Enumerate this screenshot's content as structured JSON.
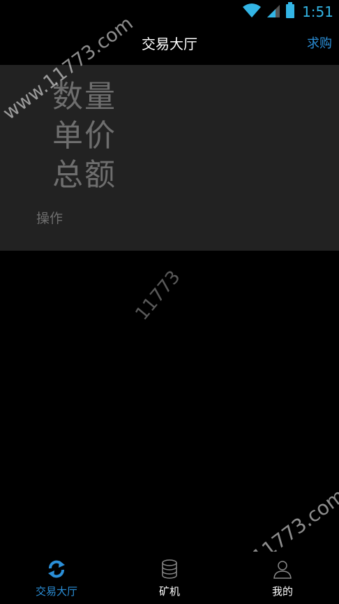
{
  "status_bar": {
    "time": "1:51",
    "icons": [
      "wifi-icon",
      "cell-signal-icon",
      "battery-icon"
    ],
    "accent_color": "#33b5e5"
  },
  "header": {
    "title": "交易大厅",
    "action_label": "求购"
  },
  "card": {
    "quantity_label": "数量",
    "price_label": "单价",
    "total_label": "总额",
    "operation_label": "操作"
  },
  "watermarks": [
    "www.11773.com",
    "11773",
    "www.11773.com"
  ],
  "bottom_nav": {
    "items": [
      {
        "label": "交易大厅",
        "icon": "refresh-icon",
        "active": true
      },
      {
        "label": "矿机",
        "icon": "database-icon",
        "active": false
      },
      {
        "label": "我的",
        "icon": "user-icon",
        "active": false
      }
    ],
    "active_color": "#2b8fd8"
  }
}
